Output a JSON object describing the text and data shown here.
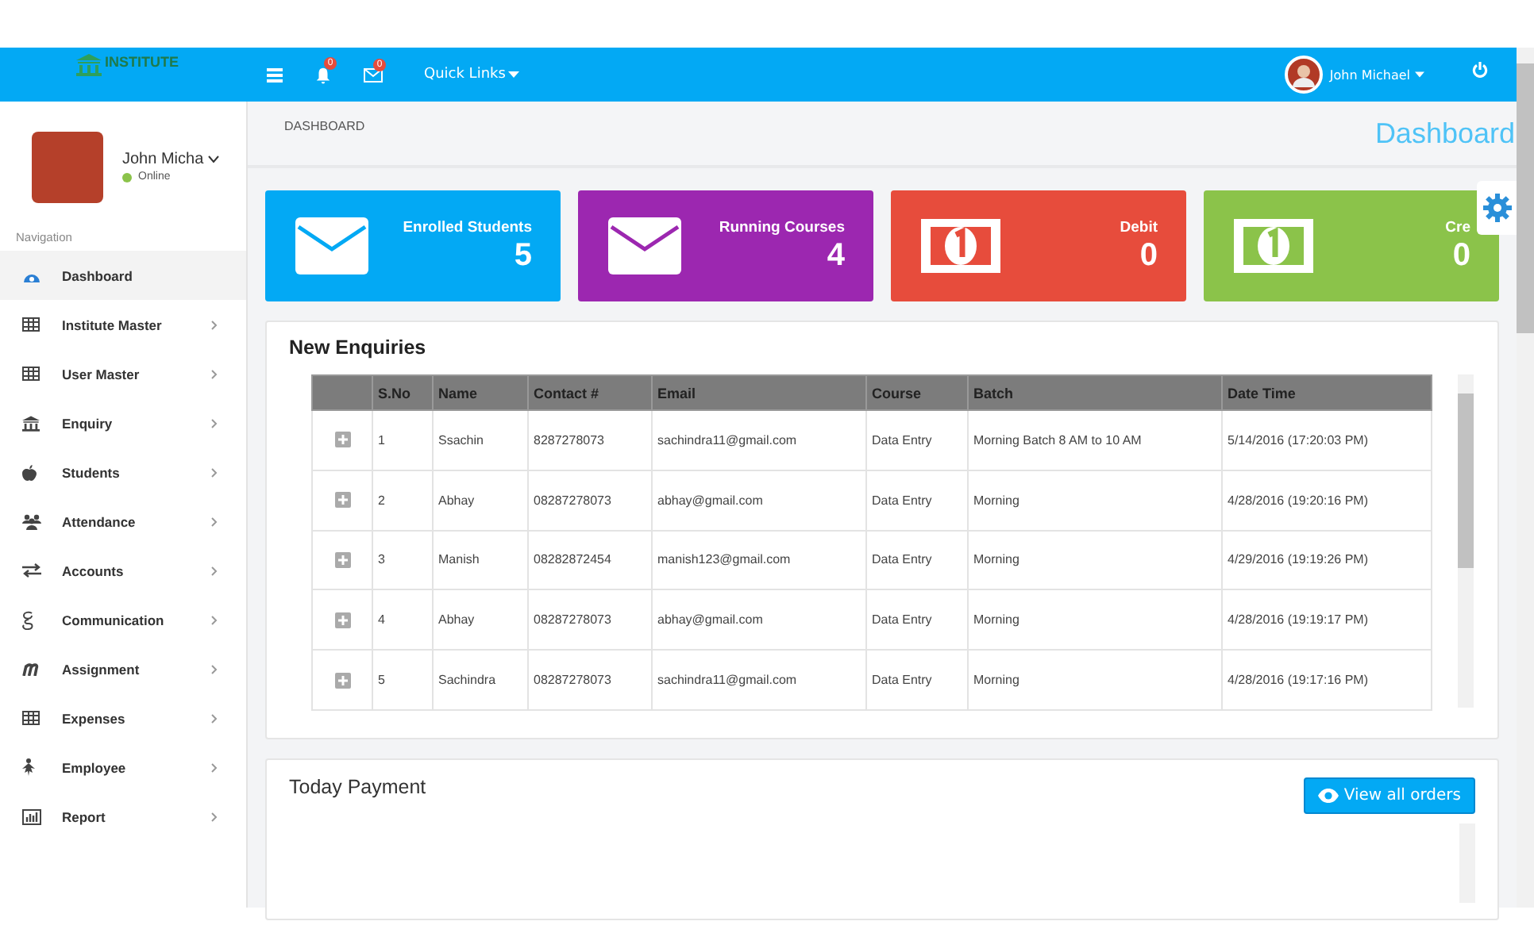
{
  "header": {
    "brand": "INSTITUTE",
    "notifications_badge": "0",
    "messages_badge": "0",
    "quick_links": "Quick Links",
    "user_name": "John Michael"
  },
  "sidebar": {
    "user_name": "John Micha",
    "status": "Online",
    "nav_heading": "Navigation",
    "items": [
      {
        "label": "Dashboard",
        "selected": true,
        "expandable": false
      },
      {
        "label": "Institute Master",
        "selected": false,
        "expandable": true
      },
      {
        "label": "User Master",
        "selected": false,
        "expandable": true
      },
      {
        "label": "Enquiry",
        "selected": false,
        "expandable": true
      },
      {
        "label": "Students",
        "selected": false,
        "expandable": true
      },
      {
        "label": "Attendance",
        "selected": false,
        "expandable": true
      },
      {
        "label": "Accounts",
        "selected": false,
        "expandable": true
      },
      {
        "label": "Communication",
        "selected": false,
        "expandable": true
      },
      {
        "label": "Assignment",
        "selected": false,
        "expandable": true
      },
      {
        "label": "Expenses",
        "selected": false,
        "expandable": true
      },
      {
        "label": "Employee",
        "selected": false,
        "expandable": true
      },
      {
        "label": "Report",
        "selected": false,
        "expandable": true
      }
    ]
  },
  "breadcrumb": "DASHBOARD",
  "page_title": "Dashboard",
  "stat_cards": [
    {
      "kind": "mail",
      "label": "Enrolled Students",
      "value": "5",
      "color": "#03a9f4"
    },
    {
      "kind": "mail",
      "label": "Running Courses",
      "value": "4",
      "color": "#9c27b0"
    },
    {
      "kind": "money",
      "label": "Debit",
      "value": "0",
      "color": "#e74c3c"
    },
    {
      "kind": "money",
      "label": "Cre",
      "value": "0",
      "color": "#8bc34a"
    }
  ],
  "enquiries": {
    "title": "New Enquiries",
    "columns": [
      "S.No",
      "Name",
      "Contact #",
      "Email",
      "Course",
      "Batch",
      "Date Time"
    ],
    "rows": [
      [
        "1",
        "Ssachin",
        "8287278073",
        "sachindra11@gmail.com",
        "Data Entry",
        "Morning Batch 8 AM to 10 AM",
        "5/14/2016 (17:20:03 PM)"
      ],
      [
        "2",
        "Abhay",
        "08287278073",
        "abhay@gmail.com",
        "Data Entry",
        "Morning",
        "4/28/2016 (19:20:16 PM)"
      ],
      [
        "3",
        "Manish",
        "08282872454",
        "manish123@gmail.com",
        "Data Entry",
        "Morning",
        "4/29/2016 (19:19:26 PM)"
      ],
      [
        "4",
        "Abhay",
        "08287278073",
        "abhay@gmail.com",
        "Data Entry",
        "Morning",
        "4/28/2016 (19:19:17 PM)"
      ],
      [
        "5",
        "Sachindra",
        "08287278073",
        "sachindra11@gmail.com",
        "Data Entry",
        "Morning",
        "4/28/2016 (19:17:16 PM)"
      ]
    ]
  },
  "payment": {
    "title": "Today Payment",
    "button": "View all orders"
  }
}
